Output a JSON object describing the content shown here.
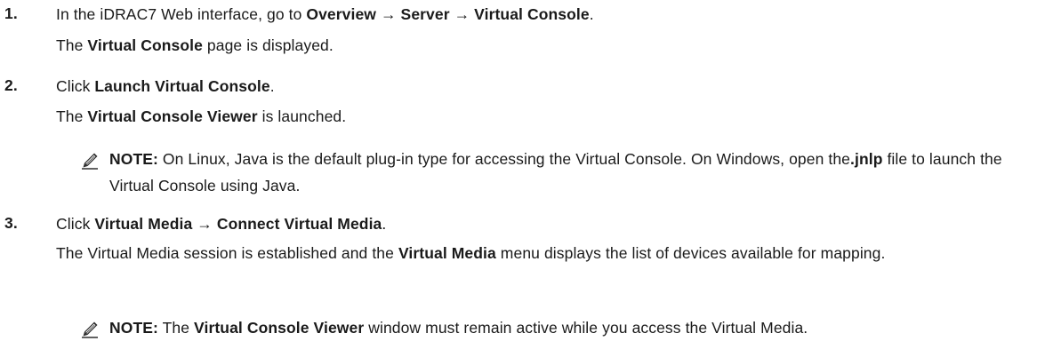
{
  "steps": [
    {
      "number": "1.",
      "instruction": {
        "t1": "In the iDRAC7 Web interface, go to ",
        "b1": "Overview",
        "t2": " → ",
        "b2": "Server",
        "t3": " → ",
        "b3": "Virtual Console",
        "t4": "."
      },
      "result": {
        "t1": "The ",
        "b1": "Virtual Console",
        "t2": " page is displayed."
      }
    },
    {
      "number": "2.",
      "instruction": {
        "t1": "Click ",
        "b1": "Launch Virtual Console",
        "t2": "."
      },
      "result": {
        "t1": "The ",
        "b1": "Virtual Console Viewer",
        "t2": " is launched."
      },
      "note": {
        "icon": "pencil-note-icon",
        "label": "NOTE:",
        "t1": " On Linux, Java is the default plug-in type for accessing the Virtual Console. On Windows, open the",
        "b1": ".jnlp",
        "t2": " file to launch the Virtual Console using Java."
      }
    },
    {
      "number": "3.",
      "instruction": {
        "t1": "Click ",
        "b1": "Virtual Media",
        "t2": " → ",
        "b2": "Connect Virtual Media",
        "t3": "."
      },
      "result": {
        "t1": "The Virtual Media session is established and the ",
        "b1": "Virtual Media",
        "t2": " menu displays the list of devices available for mapping."
      },
      "note": {
        "icon": "pencil-note-icon",
        "label": "NOTE:",
        "t1": " The ",
        "b1": "Virtual Console Viewer",
        "t2": " window must remain active while you access the Virtual Media."
      }
    }
  ]
}
